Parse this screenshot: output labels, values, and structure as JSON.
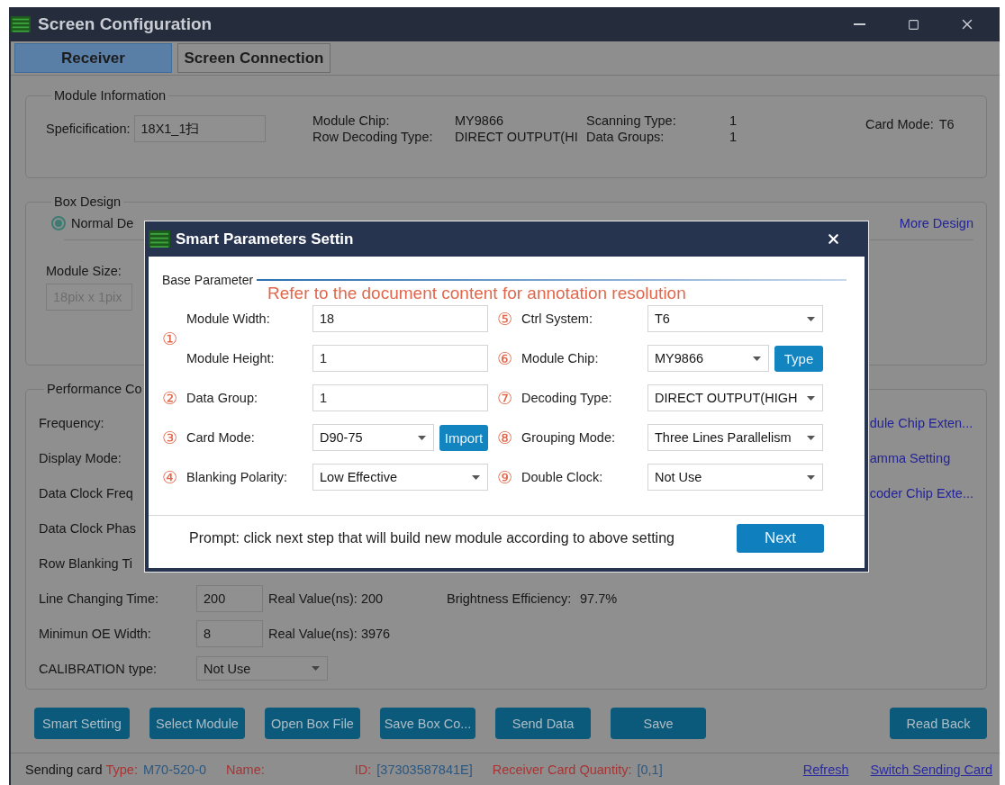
{
  "window": {
    "title": "Screen Configuration"
  },
  "tabs": [
    {
      "label": "Receiver",
      "selected": true
    },
    {
      "label": "Screen Connection",
      "selected": false
    }
  ],
  "module_information": {
    "title": "Module Information",
    "specification": {
      "label": "Speficification:",
      "value": "18X1_1扫"
    },
    "rows": [
      [
        {
          "label": "Module Chip:",
          "value": "MY9866"
        },
        {
          "label": "Scanning Type:",
          "value": "1"
        }
      ],
      [
        {
          "label": "Row Decoding Type:",
          "value": "DIRECT OUTPUT(HI"
        },
        {
          "label": "Data Groups:",
          "value": "1"
        }
      ]
    ],
    "card_mode": {
      "label": "Card Mode:",
      "value": "T6"
    }
  },
  "box_design": {
    "title": "Box Design",
    "design_option": {
      "label": "Normal De",
      "selected": true
    },
    "more_design": "More Design",
    "module_size": {
      "label": "Module Size:",
      "value": "18pix x 1pix",
      "disabled": true
    }
  },
  "performance": {
    "title": "Performance Co",
    "covered_labels": [
      "Frequency:",
      "Display Mode:",
      "Data Clock Freq",
      "Data Clock Phas",
      "Row Blanking Ti"
    ],
    "links": [
      "dule Chip Exten...",
      "amma Setting",
      "coder Chip Exte..."
    ],
    "rows": [
      {
        "label": "Line Changing Time:",
        "value": "200",
        "reading": "Real Value(ns): 200",
        "extra_label": "Brightness Efficiency:",
        "extra_value": "97.7%"
      },
      {
        "label": "Minimun OE Width:",
        "value": "8",
        "reading": "Real Value(ns): 3976"
      }
    ],
    "calibration": {
      "label": "CALIBRATION type:",
      "value": "Not Use"
    }
  },
  "buttons": [
    "Smart Setting",
    "Select Module",
    "Open Box File",
    "Save Box Co...",
    "Send Data",
    "Save"
  ],
  "read_back": "Read Back",
  "status_bar": {
    "prefix": "Sending card",
    "fields": [
      {
        "key": "Type:",
        "value": "M70-520-0"
      },
      {
        "key": "Name:"
      },
      {
        "key": "ID:",
        "value": "[37303587841E]"
      },
      {
        "key": "Receiver Card Quantity:",
        "value": "[0,1]"
      }
    ],
    "links": [
      "Refresh",
      "Switch Sending Card"
    ]
  },
  "dialog": {
    "title": "Smart Parameters Settin",
    "group_title": "Base Parameter",
    "annotation": "Refer to the document content for annotation resolution",
    "columns": [
      [
        {
          "marker": "①",
          "fields": [
            {
              "label": "Module Width:",
              "value": "18",
              "kind": "text"
            },
            {
              "label": "Module Height:",
              "value": "1",
              "kind": "text"
            }
          ]
        },
        {
          "marker": "②",
          "fields": [
            {
              "label": "Data Group:",
              "value": "1",
              "kind": "text"
            }
          ]
        },
        {
          "marker": "③",
          "fields": [
            {
              "label": "Card Mode:",
              "value": "D90-75",
              "kind": "select",
              "button": "Import"
            }
          ]
        },
        {
          "marker": "④",
          "fields": [
            {
              "label": "Blanking Polarity:",
              "value": "Low Effective",
              "kind": "select"
            }
          ]
        }
      ],
      [
        {
          "marker": "⑤",
          "fields": [
            {
              "label": "Ctrl System:",
              "value": "T6",
              "kind": "select"
            }
          ]
        },
        {
          "marker": "⑥",
          "fields": [
            {
              "label": "Module Chip:",
              "value": "MY9866",
              "kind": "select",
              "button": "Type"
            }
          ]
        },
        {
          "marker": "⑦",
          "fields": [
            {
              "label": "Decoding Type:",
              "value": "DIRECT OUTPUT(HIGH",
              "kind": "select"
            }
          ]
        },
        {
          "marker": "⑧",
          "fields": [
            {
              "label": "Grouping Mode:",
              "value": "Three Lines Parallelism",
              "kind": "select"
            }
          ]
        },
        {
          "marker": "⑨",
          "fields": [
            {
              "label": "Double Clock:",
              "value": "Not Use",
              "kind": "select"
            }
          ]
        }
      ]
    ],
    "prompt": "Prompt: click next step that will build new module according to above setting",
    "next": "Next"
  }
}
